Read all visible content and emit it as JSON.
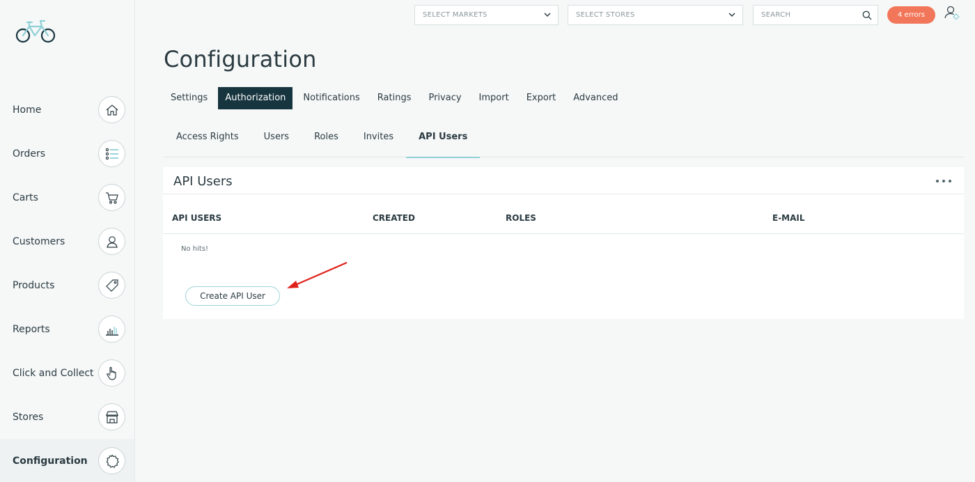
{
  "sidebar": {
    "items": [
      {
        "label": "Home",
        "icon": "home-icon"
      },
      {
        "label": "Orders",
        "icon": "list-icon"
      },
      {
        "label": "Carts",
        "icon": "cart-icon"
      },
      {
        "label": "Customers",
        "icon": "customer-icon"
      },
      {
        "label": "Products",
        "icon": "tag-icon"
      },
      {
        "label": "Reports",
        "icon": "bar-chart-icon"
      },
      {
        "label": "Click and Collect",
        "icon": "hand-pointer-icon"
      },
      {
        "label": "Stores",
        "icon": "store-icon"
      },
      {
        "label": "Configuration",
        "icon": "gear-icon",
        "active": true
      }
    ]
  },
  "topbar": {
    "markets_placeholder": "SELECT MARKETS",
    "stores_placeholder": "SELECT STORES",
    "search_placeholder": "SEARCH",
    "errors_label": "4 errors"
  },
  "colors": {
    "accent_dark": "#17353f",
    "accent_light": "#8fd0d6",
    "error": "#f2765a",
    "annotation_arrow": "#e0201b"
  },
  "page": {
    "title": "Configuration",
    "tabs": [
      "Settings",
      "Authorization",
      "Notifications",
      "Ratings",
      "Privacy",
      "Import",
      "Export",
      "Advanced"
    ],
    "active_tab": "Authorization",
    "subtabs": [
      "Access Rights",
      "Users",
      "Roles",
      "Invites",
      "API Users"
    ],
    "active_subtab": "API Users"
  },
  "card": {
    "title": "API Users",
    "columns": [
      "API USERS",
      "CREATED",
      "ROLES",
      "E-MAIL"
    ],
    "empty_text": "No hits!",
    "create_button": "Create API User"
  }
}
